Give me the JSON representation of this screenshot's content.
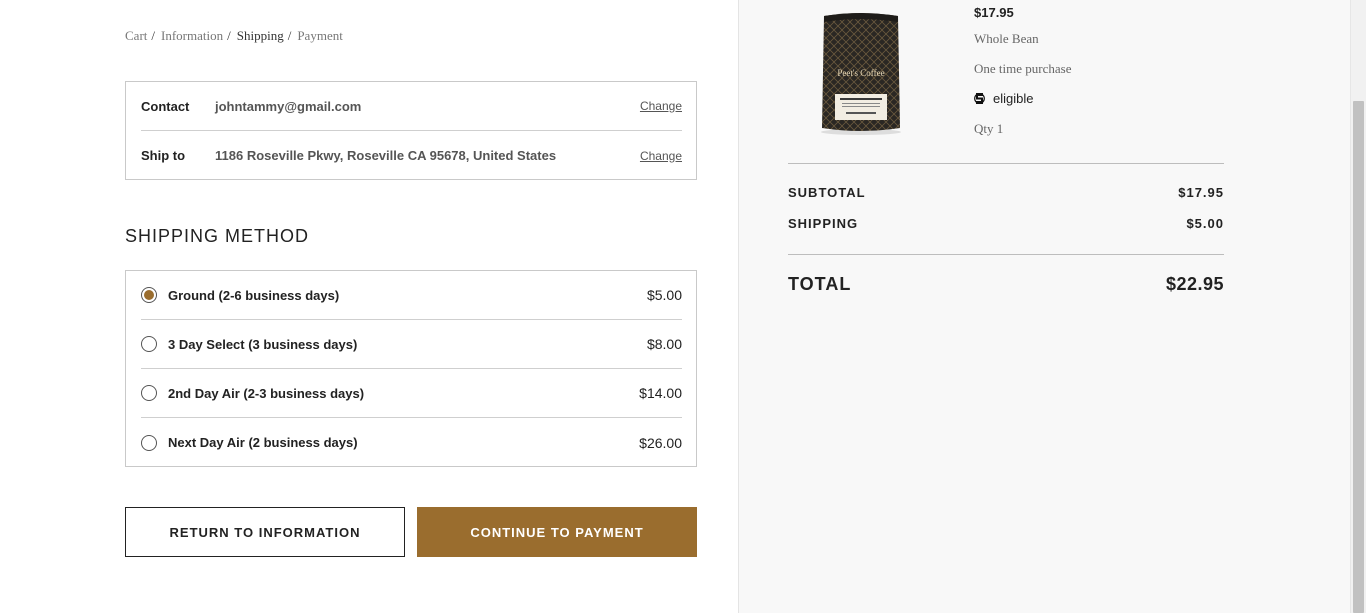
{
  "breadcrumb": [
    {
      "label": "Cart",
      "active": false
    },
    {
      "label": "Information",
      "active": false
    },
    {
      "label": "Shipping",
      "active": true
    },
    {
      "label": "Payment",
      "active": false
    }
  ],
  "review": {
    "contact_label": "Contact",
    "contact_value": "johntammy@gmail.com",
    "ship_to_label": "Ship to",
    "ship_to_value": "1186 Roseville Pkwy, Roseville CA 95678, United States",
    "change_label": "Change"
  },
  "shipping": {
    "title": "SHIPPING METHOD",
    "methods": [
      {
        "name": "Ground (2-6 business days)",
        "price": "$5.00",
        "selected": true
      },
      {
        "name": "3 Day Select (3 business days)",
        "price": "$8.00",
        "selected": false
      },
      {
        "name": "2nd Day Air (2-3 business days)",
        "price": "$14.00",
        "selected": false
      },
      {
        "name": "Next Day Air (2 business days)",
        "price": "$26.00",
        "selected": false
      }
    ]
  },
  "buttons": {
    "return": "RETURN TO INFORMATION",
    "continue": "CONTINUE TO PAYMENT"
  },
  "product": {
    "price": "$17.95",
    "grind": "Whole Bean",
    "purchase_type": "One time purchase",
    "eligible_label": "eligible",
    "qty": "Qty 1",
    "brand_text": "Peet's Coffee"
  },
  "summary": {
    "subtotal_label": "SUBTOTAL",
    "subtotal_value": "$17.95",
    "shipping_label": "SHIPPING",
    "shipping_value": "$5.00",
    "total_label": "TOTAL",
    "total_value": "$22.95"
  },
  "colors": {
    "accent": "#9a6d2e",
    "summary_bg": "#f8f8f8"
  }
}
